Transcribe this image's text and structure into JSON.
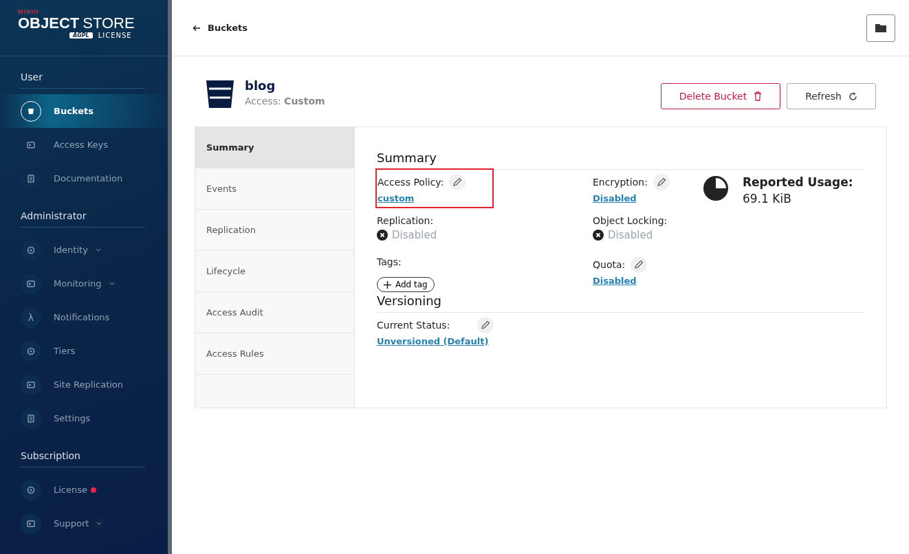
{
  "logo": {
    "brand": "MINIO",
    "product_bold": "OBJECT",
    "product_light": "STORE",
    "badge": "AGPL",
    "license": "LICENSE"
  },
  "sidebar": {
    "sections": [
      {
        "title": "User",
        "items": [
          {
            "label": "Buckets",
            "selected": true
          },
          {
            "label": "Access Keys",
            "selected": false
          },
          {
            "label": "Documentation",
            "selected": false
          }
        ]
      },
      {
        "title": "Administrator",
        "items": [
          {
            "label": "Identity",
            "selected": false,
            "expandable": true
          },
          {
            "label": "Monitoring",
            "selected": false,
            "expandable": true
          },
          {
            "label": "Notifications",
            "selected": false,
            "glyph": "λ"
          },
          {
            "label": "Tiers",
            "selected": false
          },
          {
            "label": "Site Replication",
            "selected": false
          },
          {
            "label": "Settings",
            "selected": false
          }
        ]
      },
      {
        "title": "Subscription",
        "items": [
          {
            "label": "License",
            "selected": false,
            "color": "#e9234d"
          },
          {
            "label": "Support",
            "selected": false,
            "expandable": true
          }
        ]
      }
    ]
  },
  "header": {
    "back_label": "Buckets"
  },
  "bucket": {
    "name": "blog",
    "access_label": "Access:",
    "access_value": "Custom"
  },
  "actions": [
    {
      "label": "Delete Bucket",
      "kind": "danger"
    },
    {
      "label": "Refresh",
      "kind": "refresh"
    }
  ],
  "tabs": [
    {
      "label": "Summary",
      "selected": true
    },
    {
      "label": "Events",
      "selected": false
    },
    {
      "label": "Replication",
      "selected": false
    },
    {
      "label": "Lifecycle",
      "selected": false
    },
    {
      "label": "Access Audit",
      "selected": false
    },
    {
      "label": "Access Rules",
      "selected": false
    }
  ],
  "summary": {
    "title": "Summary",
    "fields": [
      {
        "label": "Access Policy:",
        "kind": "link",
        "value": "custom",
        "editable": true,
        "highlighted": true
      },
      {
        "label": "Encryption:",
        "kind": "link",
        "value": "Disabled",
        "editable": true,
        "highlighted": false
      },
      {
        "label": "Replication:",
        "kind": "status",
        "value": "Disabled",
        "editable": false,
        "highlighted": false
      },
      {
        "label": "Object Locking:",
        "kind": "status",
        "value": "Disabled",
        "editable": false,
        "highlighted": false
      },
      {
        "label": "Tags:",
        "kind": "tags",
        "value": "Add tag",
        "editable": false,
        "highlighted": false
      },
      {
        "label": "Quota:",
        "kind": "link",
        "value": "Disabled",
        "editable": true,
        "highlighted": false
      }
    ],
    "usage": {
      "label": "Reported Usage:",
      "value": "69.1 KiB"
    }
  },
  "versioning": {
    "title": "Versioning",
    "label": "Current Status:",
    "value": "Unversioned (Default)",
    "editable": true
  }
}
